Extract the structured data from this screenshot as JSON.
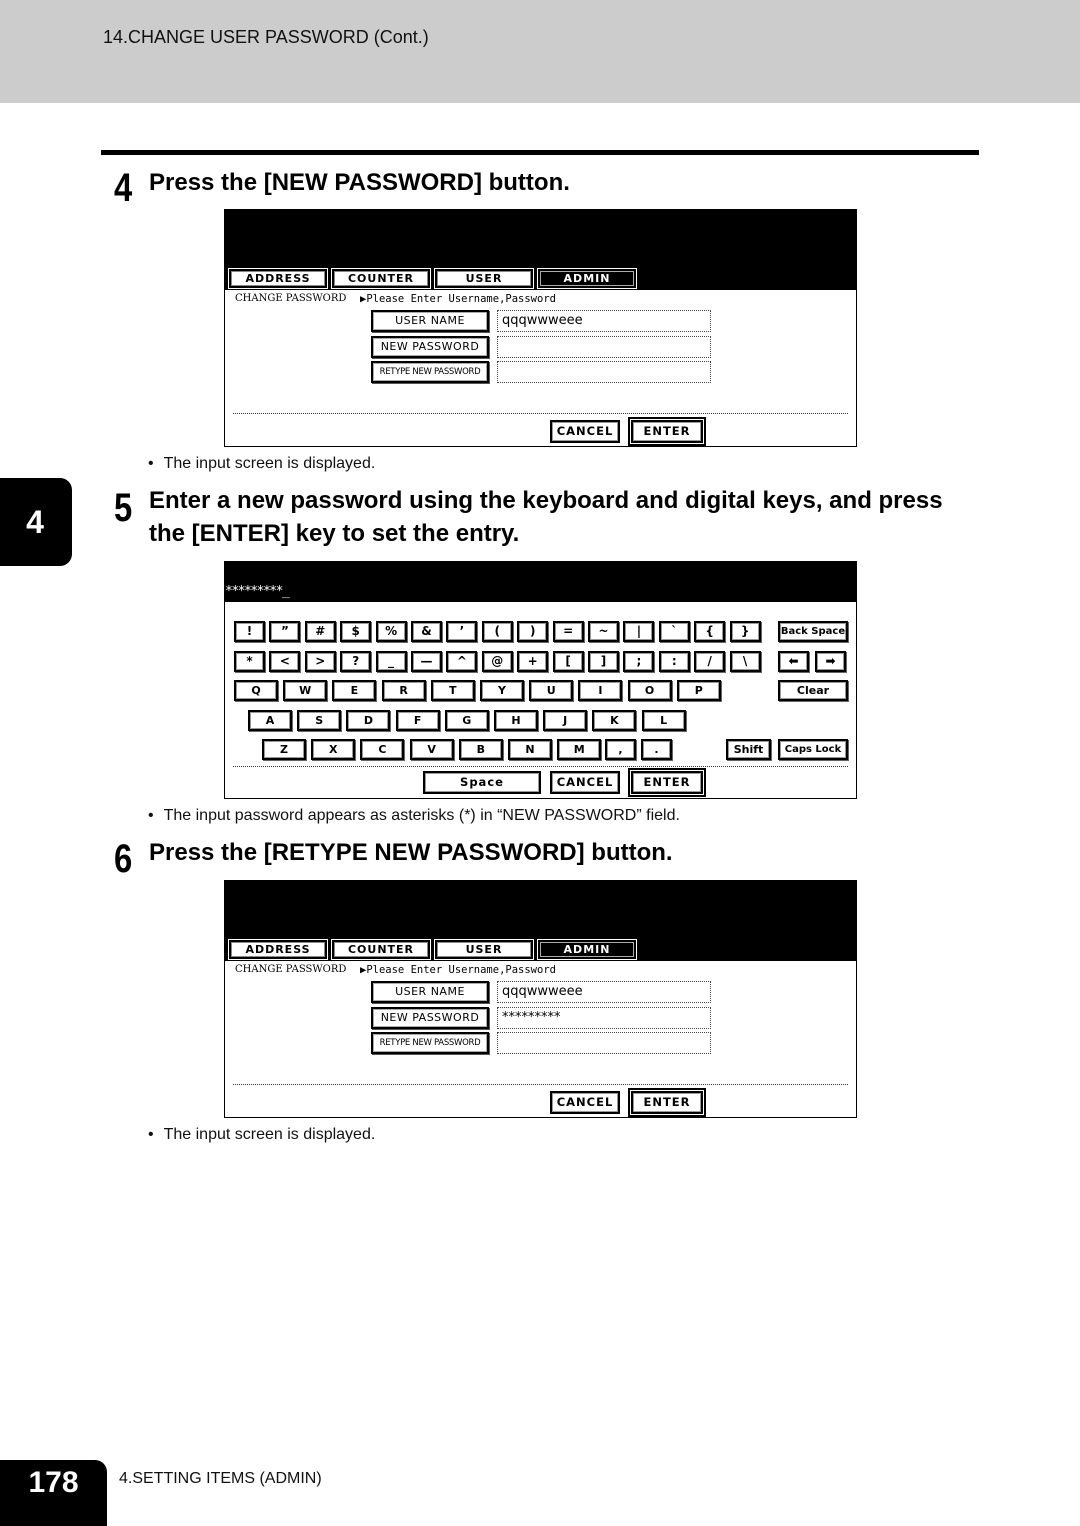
{
  "header": {
    "title": "14.CHANGE USER PASSWORD (Cont.)"
  },
  "chapter_tab": "4",
  "footer": {
    "page_number": "178",
    "section": "4.SETTING ITEMS (ADMIN)"
  },
  "steps": [
    {
      "number": "4",
      "title": "Press the [NEW PASSWORD] button.",
      "note": "The input screen is displayed."
    },
    {
      "number": "5",
      "title_line1": "Enter a new password using the keyboard and digital keys, and press",
      "title_line2": "the [ENTER] key to set the entry.",
      "note": "The input password appears as asterisks (*) in “NEW PASSWORD” field."
    },
    {
      "number": "6",
      "title": "Press the [RETYPE NEW PASSWORD] button.",
      "note": "The input screen is displayed."
    }
  ],
  "bullet": "•",
  "screen1": {
    "tabs": [
      "ADDRESS",
      "COUNTER",
      "USER",
      "ADMIN"
    ],
    "active_tab": "ADMIN",
    "crumb": "CHANGE PASSWORD",
    "prompt": "▶Please Enter Username,Password",
    "fields": [
      {
        "label": "USER NAME",
        "value": "qqqwwweee"
      },
      {
        "label": "NEW PASSWORD",
        "value": ""
      },
      {
        "label": "RETYPE NEW PASSWORD",
        "value": ""
      }
    ],
    "cancel": "CANCEL",
    "enter": "ENTER"
  },
  "keyboard": {
    "entry": "*********_",
    "row1": [
      "!",
      "”",
      "#",
      "$",
      "%",
      "&",
      "’",
      "(",
      ")",
      "=",
      "~",
      "|",
      "`",
      "{",
      "}"
    ],
    "row2": [
      "*",
      "<",
      ">",
      "?",
      "_",
      "—",
      "^",
      "@",
      "+",
      "[",
      "]",
      ";",
      ":",
      "/",
      "\\"
    ],
    "row3": [
      "Q",
      "W",
      "E",
      "R",
      "T",
      "Y",
      "U",
      "I",
      "O",
      "P"
    ],
    "row4": [
      "A",
      "S",
      "D",
      "F",
      "G",
      "H",
      "J",
      "K",
      "L"
    ],
    "row5": [
      "Z",
      "X",
      "C",
      "V",
      "B",
      "N",
      "M",
      ",",
      "."
    ],
    "backspace": "Back Space",
    "left_arrow": "⬅",
    "right_arrow": "➡",
    "clear": "Clear",
    "shift": "Shift",
    "caps_lock": "Caps Lock",
    "space": "Space",
    "cancel": "CANCEL",
    "enter": "ENTER"
  },
  "screen2": {
    "tabs": [
      "ADDRESS",
      "COUNTER",
      "USER",
      "ADMIN"
    ],
    "active_tab": "ADMIN",
    "crumb": "CHANGE PASSWORD",
    "prompt": "▶Please Enter Username,Password",
    "fields": [
      {
        "label": "USER NAME",
        "value": "qqqwwweee"
      },
      {
        "label": "NEW PASSWORD",
        "value": "*********"
      },
      {
        "label": "RETYPE NEW PASSWORD",
        "value": ""
      }
    ],
    "cancel": "CANCEL",
    "enter": "ENTER"
  }
}
